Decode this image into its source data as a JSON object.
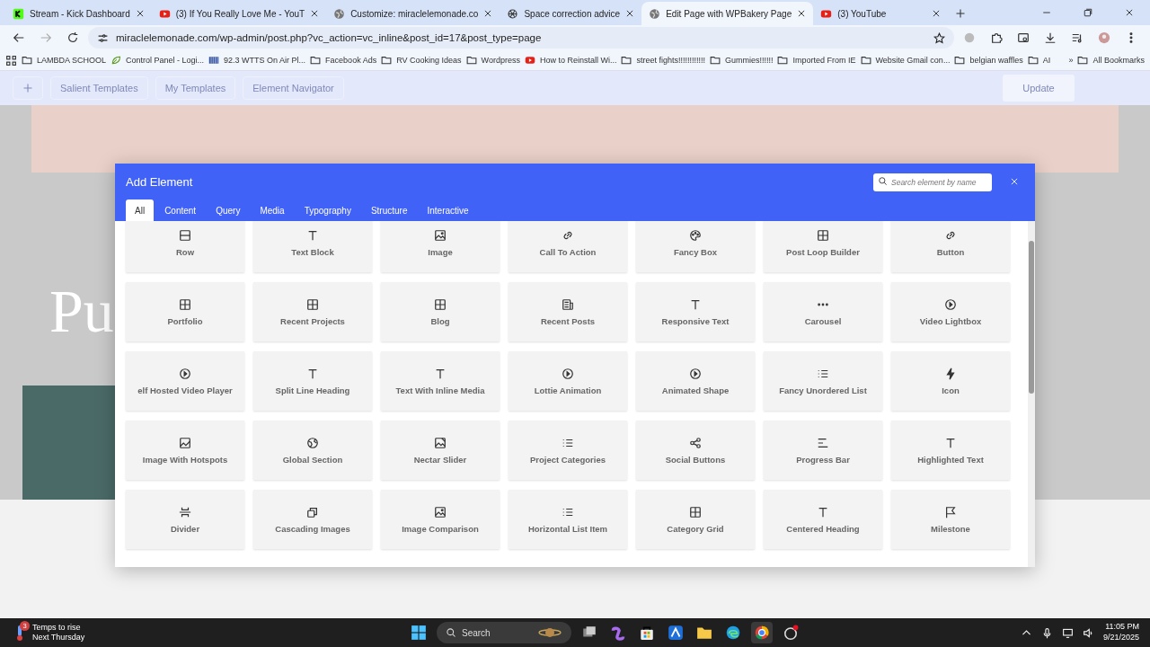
{
  "browser": {
    "tabs": [
      {
        "title": "Stream - Kick Dashboard",
        "kind": "logo",
        "selected": false
      },
      {
        "title": "(3) If You Really Love Me - YouT",
        "kind": "video",
        "selected": false
      },
      {
        "title": "Customize: miraclelemonade.co",
        "kind": "globe",
        "selected": false
      },
      {
        "title": "Space correction advice",
        "kind": "knot",
        "selected": false
      },
      {
        "title": "Edit Page with WPBakery Page",
        "kind": "globe",
        "selected": true
      },
      {
        "title": "(3) YouTube",
        "kind": "video",
        "selected": false
      }
    ],
    "address": "miraclelemonade.com/wp-admin/post.php?vc_action=vc_inline&post_id=17&post_type=page",
    "bookmarks": [
      {
        "label": "LAMBDA SCHOOL",
        "kind": "folder"
      },
      {
        "label": "Control Panel - Logi...",
        "kind": "leaf"
      },
      {
        "label": "92.3 WTTS On Air Pl...",
        "kind": "grid"
      },
      {
        "label": "Facebook Ads",
        "kind": "folder"
      },
      {
        "label": "RV Cooking Ideas",
        "kind": "folder"
      },
      {
        "label": "Wordpress",
        "kind": "folder"
      },
      {
        "label": "How to Reinstall Wi...",
        "kind": "video"
      },
      {
        "label": "street fights!!!!!!!!!!!!",
        "kind": "folder"
      },
      {
        "label": "Gummies!!!!!!",
        "kind": "folder"
      },
      {
        "label": "Imported From IE",
        "kind": "folder"
      },
      {
        "label": "Website Gmail con...",
        "kind": "folder"
      },
      {
        "label": "belgian waffles",
        "kind": "folder"
      },
      {
        "label": "AI",
        "kind": "folder"
      }
    ],
    "more": "»",
    "all_bookmarks": "All Bookmarks"
  },
  "builder_toolbar": {
    "buttons": [
      "Salient Templates",
      "My Templates",
      "Element Navigator"
    ],
    "update": "Update"
  },
  "page": {
    "hero_text": "Pu"
  },
  "modal": {
    "title": "Add Element",
    "search": {
      "placeholder": "Search element by name"
    },
    "tabs": [
      {
        "label": "All",
        "selected": true
      },
      {
        "label": "Content",
        "selected": false
      },
      {
        "label": "Query",
        "selected": false
      },
      {
        "label": "Media",
        "selected": false
      },
      {
        "label": "Typography",
        "selected": false
      },
      {
        "label": "Structure",
        "selected": false
      },
      {
        "label": "Interactive",
        "selected": false
      }
    ],
    "elements": [
      {
        "label": "Row",
        "kind": "row"
      },
      {
        "label": "Text Block",
        "kind": "text"
      },
      {
        "label": "Image",
        "kind": "image"
      },
      {
        "label": "Call To Action",
        "kind": "link"
      },
      {
        "label": "Fancy Box",
        "kind": "palette"
      },
      {
        "label": "Post Loop Builder",
        "kind": "grid"
      },
      {
        "label": "Button",
        "kind": "link"
      },
      {
        "label": "Portfolio",
        "kind": "grid"
      },
      {
        "label": "Recent Projects",
        "kind": "grid"
      },
      {
        "label": "Blog",
        "kind": "grid"
      },
      {
        "label": "Recent Posts",
        "kind": "doc"
      },
      {
        "label": "Responsive Text",
        "kind": "text"
      },
      {
        "label": "Carousel",
        "kind": "dots"
      },
      {
        "label": "Video Lightbox",
        "kind": "play"
      },
      {
        "label": "elf Hosted Video Player",
        "kind": "play"
      },
      {
        "label": "Split Line Heading",
        "kind": "text"
      },
      {
        "label": "Text With Inline Media",
        "kind": "text"
      },
      {
        "label": "Lottie Animation",
        "kind": "play"
      },
      {
        "label": "Animated Shape",
        "kind": "play"
      },
      {
        "label": "Fancy Unordered List",
        "kind": "list"
      },
      {
        "label": "Icon",
        "kind": "bolt"
      },
      {
        "label": "Image With Hotspots",
        "kind": "hotspot"
      },
      {
        "label": "Global Section",
        "kind": "globe"
      },
      {
        "label": "Nectar Slider",
        "kind": "slider"
      },
      {
        "label": "Project Categories",
        "kind": "list"
      },
      {
        "label": "Social Buttons",
        "kind": "share"
      },
      {
        "label": "Progress Bar",
        "kind": "bars"
      },
      {
        "label": "Highlighted Text",
        "kind": "text"
      },
      {
        "label": "Divider",
        "kind": "divider"
      },
      {
        "label": "Cascading Images",
        "kind": "layers"
      },
      {
        "label": "Image Comparison",
        "kind": "image"
      },
      {
        "label": "Horizontal List Item",
        "kind": "list"
      },
      {
        "label": "Category Grid",
        "kind": "grid"
      },
      {
        "label": "Centered Heading",
        "kind": "text"
      },
      {
        "label": "Milestone",
        "kind": "flag"
      }
    ]
  },
  "taskbar": {
    "weather": {
      "badge": "3",
      "title": "Temps to rise",
      "subtitle": "Next Thursday"
    },
    "search": "Search",
    "apps": [
      {
        "kind": "taskview",
        "selected": false
      },
      {
        "kind": "swirl",
        "selected": false
      },
      {
        "kind": "store",
        "selected": false
      },
      {
        "kind": "tile",
        "selected": false
      },
      {
        "kind": "folder",
        "selected": false
      },
      {
        "kind": "edge",
        "selected": false
      },
      {
        "kind": "chrome",
        "selected": true
      },
      {
        "kind": "recorder",
        "selected": false
      }
    ],
    "time": "11:05 PM",
    "date": "9/21/2025"
  }
}
